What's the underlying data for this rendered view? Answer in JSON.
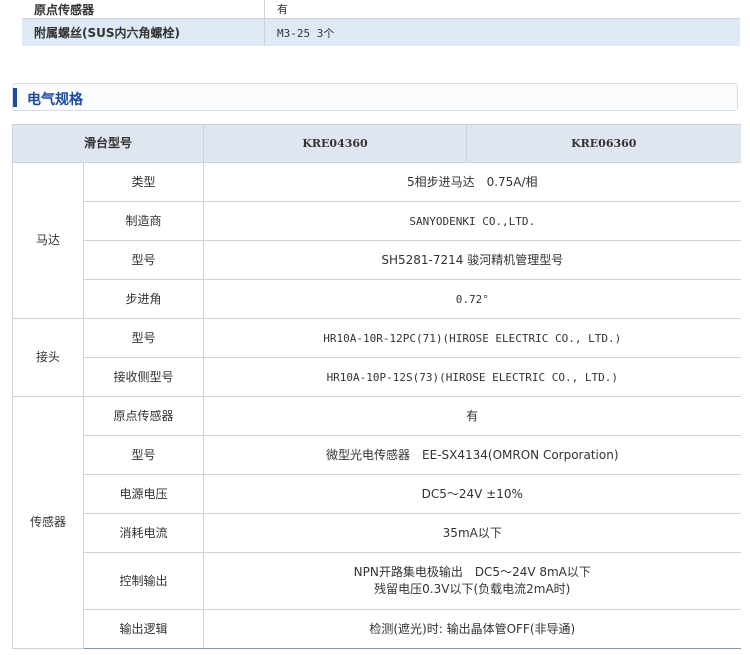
{
  "top_rows": [
    {
      "label": "原点传感器",
      "value": "有"
    },
    {
      "label": "附属螺丝(SUS内六角螺栓)",
      "value": "M3-25 3个"
    }
  ],
  "section": {
    "title": "电气规格"
  },
  "spec": {
    "header": {
      "col1": "滑台型号",
      "model1": "KRE04360",
      "model2": "KRE06360"
    },
    "groups": {
      "motor": {
        "name": "马达",
        "rows": [
          {
            "label": "类型",
            "value": "5相步进马达　0.75A/相"
          },
          {
            "label": "制造商",
            "value": "SANYODENKI CO.,LTD."
          },
          {
            "label": "型号",
            "value": "SH5281-7214 骏河精机管理型号"
          },
          {
            "label": "步进角",
            "value": "0.72°"
          }
        ]
      },
      "connector": {
        "name": "接头",
        "rows": [
          {
            "label": "型号",
            "value": "HR10A-10R-12PC(71)(HIROSE ELECTRIC CO., LTD.)"
          },
          {
            "label": "接收侧型号",
            "value": "HR10A-10P-12S(73)(HIROSE ELECTRIC CO., LTD.)"
          }
        ]
      },
      "sensor": {
        "name": "传感器",
        "rows": [
          {
            "label": "原点传感器",
            "value": "有"
          },
          {
            "label": "型号",
            "value": "微型光电传感器　EE-SX4134(OMRON Corporation)"
          },
          {
            "label": "电源电压",
            "value": "DC5～24V ±10%"
          },
          {
            "label": "消耗电流",
            "value": "35mA以下"
          },
          {
            "label": "控制输出",
            "value_line1": "NPN开路集电极输出　DC5～24V 8mA以下",
            "value_line2": "残留电压0.3V以下(负载电流2mA时)"
          },
          {
            "label": "输出逻辑",
            "value": "检测(遮光)时: 输出晶体管OFF(非导通)"
          }
        ]
      }
    }
  },
  "colors": {
    "accent": "#1e4ba0",
    "header_bg": "#dfe6ef",
    "stripe_bg": "#dfe9f5",
    "border": "#c9d2dd"
  }
}
